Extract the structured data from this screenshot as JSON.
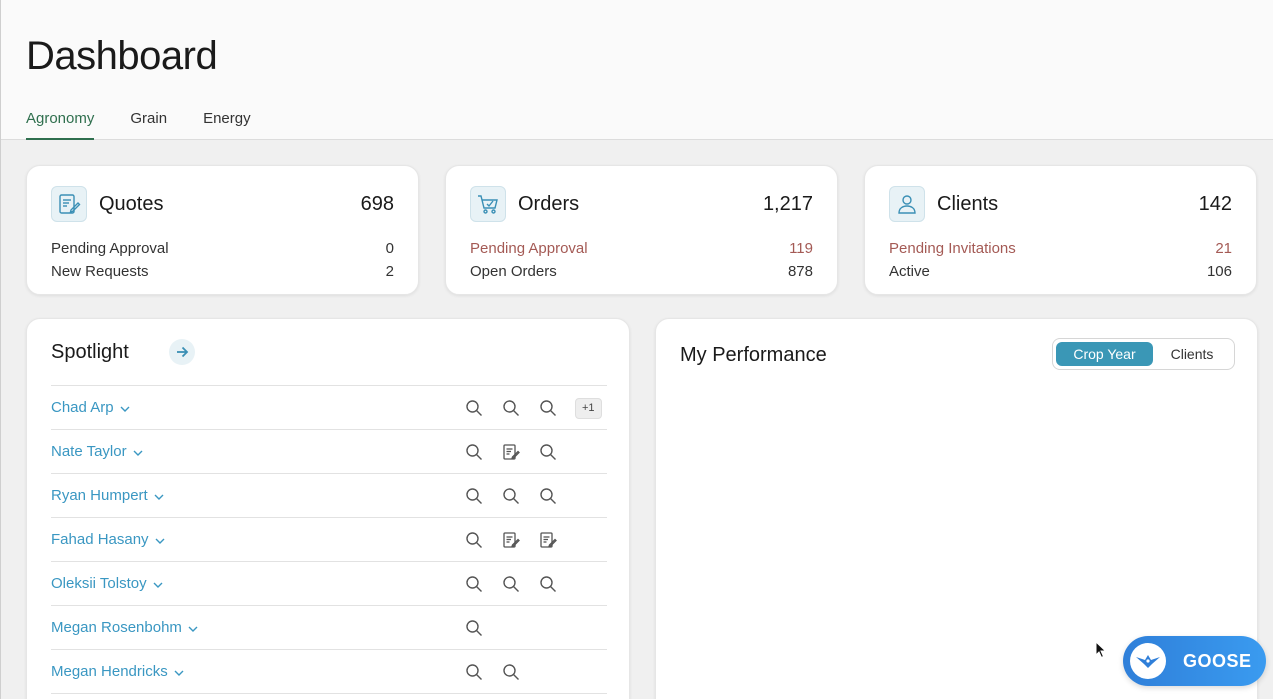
{
  "page": {
    "title": "Dashboard"
  },
  "tabs": [
    {
      "label": "Agronomy",
      "active": true
    },
    {
      "label": "Grain",
      "active": false
    },
    {
      "label": "Energy",
      "active": false
    }
  ],
  "stats": {
    "quotes": {
      "icon": "quote-document-icon",
      "title": "Quotes",
      "total": "698",
      "rows": [
        {
          "label": "Pending Approval",
          "value": "0"
        },
        {
          "label": "New Requests",
          "value": "2"
        }
      ]
    },
    "orders": {
      "icon": "cart-icon",
      "title": "Orders",
      "total": "1,217",
      "rows": [
        {
          "label": "Pending Approval",
          "value": "119"
        },
        {
          "label": "Open Orders",
          "value": "878"
        }
      ]
    },
    "clients": {
      "icon": "person-icon",
      "title": "Clients",
      "total": "142",
      "rows": [
        {
          "label": "Pending Invitations",
          "value": "21"
        },
        {
          "label": "Active",
          "value": "106"
        }
      ]
    }
  },
  "colors": {
    "alert_text": "#a45a55",
    "link": "#3a97c2",
    "accent": "#3a97b6",
    "tab_active": "#2f6f4e"
  },
  "spotlight": {
    "title": "Spotlight",
    "more_badge": "+1",
    "rows": [
      {
        "name": "Chad Arp",
        "icons": [
          "search-icon",
          "search-icon",
          "search-icon"
        ]
      },
      {
        "name": "Nate Taylor",
        "icons": [
          "search-icon",
          "quote-document-icon",
          "search-icon"
        ]
      },
      {
        "name": "Ryan Humpert",
        "icons": [
          "search-icon",
          "search-icon",
          "search-icon"
        ]
      },
      {
        "name": "Fahad Hasany",
        "icons": [
          "search-icon",
          "quote-document-icon",
          "quote-document-icon"
        ]
      },
      {
        "name": "Oleksii Tolstoy",
        "icons": [
          "search-icon",
          "search-icon",
          "search-icon"
        ]
      },
      {
        "name": "Megan Rosenbohm",
        "icons": [
          "search-icon"
        ]
      },
      {
        "name": "Megan Hendricks",
        "icons": [
          "search-icon",
          "search-icon"
        ]
      }
    ]
  },
  "performance": {
    "title": "My Performance",
    "toggle": [
      {
        "label": "Crop Year",
        "selected": true
      },
      {
        "label": "Clients",
        "selected": false
      }
    ]
  },
  "goose": {
    "label": "GOOSE"
  }
}
